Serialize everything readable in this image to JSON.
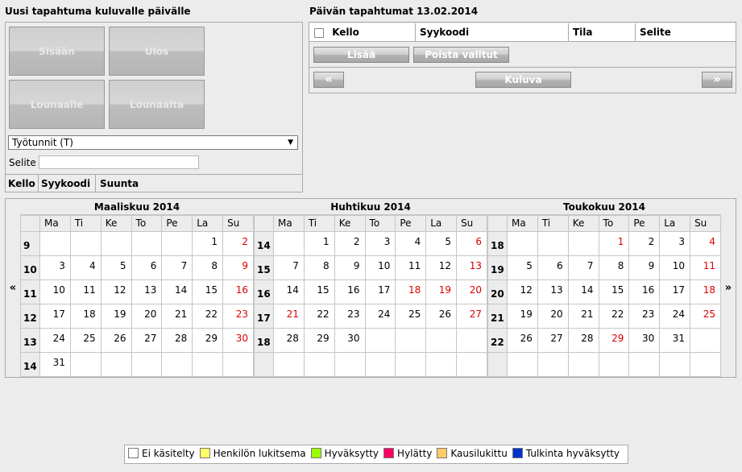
{
  "left": {
    "title": "Uusi tapahtuma kuluvalle päivälle",
    "buttons": [
      "Sisään",
      "Ulos",
      "Lounaalle",
      "Lounaalta"
    ],
    "select_value": "Työtunnit (T)",
    "selite_label": "Selite",
    "columns": [
      "Kello",
      "Syykoodi",
      "Suunta"
    ]
  },
  "right": {
    "title": "Päivän tapahtumat 13.02.2014",
    "columns": [
      "Kello",
      "Syykoodi",
      "Tila",
      "Selite"
    ],
    "add_label": "Lisää",
    "remove_label": "Poista valitut",
    "prev_label": "«",
    "current_label": "Kuluva",
    "next_label": "»"
  },
  "calendar": {
    "prev": "«",
    "next": "»",
    "day_headers": [
      "Ma",
      "Ti",
      "Ke",
      "To",
      "Pe",
      "La",
      "Su"
    ],
    "months": [
      {
        "title": "Maaliskuu 2014",
        "weeks": [
          {
            "wk": "9",
            "days": [
              "",
              "",
              "",
              "",
              "",
              "1",
              "2"
            ]
          },
          {
            "wk": "10",
            "days": [
              "3",
              "4",
              "5",
              "6",
              "7",
              "8",
              "9"
            ]
          },
          {
            "wk": "11",
            "days": [
              "10",
              "11",
              "12",
              "13",
              "14",
              "15",
              "16"
            ]
          },
          {
            "wk": "12",
            "days": [
              "17",
              "18",
              "19",
              "20",
              "21",
              "22",
              "23"
            ]
          },
          {
            "wk": "13",
            "days": [
              "24",
              "25",
              "26",
              "27",
              "28",
              "29",
              "30"
            ]
          },
          {
            "wk": "14",
            "days": [
              "31",
              "",
              "",
              "",
              "",
              "",
              ""
            ]
          }
        ],
        "red": [
          "2",
          "9",
          "16",
          "23",
          "30"
        ]
      },
      {
        "title": "Huhtikuu 2014",
        "weeks": [
          {
            "wk": "14",
            "days": [
              "",
              "1",
              "2",
              "3",
              "4",
              "5",
              "6"
            ]
          },
          {
            "wk": "15",
            "days": [
              "7",
              "8",
              "9",
              "10",
              "11",
              "12",
              "13"
            ]
          },
          {
            "wk": "16",
            "days": [
              "14",
              "15",
              "16",
              "17",
              "18",
              "19",
              "20"
            ]
          },
          {
            "wk": "17",
            "days": [
              "21",
              "22",
              "23",
              "24",
              "25",
              "26",
              "27"
            ]
          },
          {
            "wk": "18",
            "days": [
              "28",
              "29",
              "30",
              "",
              "",
              "",
              ""
            ]
          },
          {
            "wk": "",
            "days": [
              "",
              "",
              "",
              "",
              "",
              "",
              ""
            ]
          }
        ],
        "red": [
          "6",
          "13",
          "18",
          "19",
          "20",
          "21",
          "27"
        ]
      },
      {
        "title": "Toukokuu 2014",
        "weeks": [
          {
            "wk": "18",
            "days": [
              "",
              "",
              "",
              "1",
              "2",
              "3",
              "4"
            ]
          },
          {
            "wk": "19",
            "days": [
              "5",
              "6",
              "7",
              "8",
              "9",
              "10",
              "11"
            ]
          },
          {
            "wk": "20",
            "days": [
              "12",
              "13",
              "14",
              "15",
              "16",
              "17",
              "18"
            ]
          },
          {
            "wk": "21",
            "days": [
              "19",
              "20",
              "21",
              "22",
              "23",
              "24",
              "25"
            ]
          },
          {
            "wk": "22",
            "days": [
              "26",
              "27",
              "28",
              "29",
              "30",
              "31",
              ""
            ]
          },
          {
            "wk": "",
            "days": [
              "",
              "",
              "",
              "",
              "",
              "",
              ""
            ]
          }
        ],
        "red": [
          "1",
          "4",
          "11",
          "18",
          "25",
          "29"
        ]
      }
    ]
  },
  "legend": [
    {
      "label": "Ei käsitelty",
      "color": "#ffffff"
    },
    {
      "label": "Henkilön lukitsema",
      "color": "#ffff66"
    },
    {
      "label": "Hyväksytty",
      "color": "#99ff00"
    },
    {
      "label": "Hylätty",
      "color": "#ff0066"
    },
    {
      "label": "Kausilukittu",
      "color": "#ffcc66"
    },
    {
      "label": "Tulkinta hyväksytty",
      "color": "#0033cc"
    }
  ]
}
